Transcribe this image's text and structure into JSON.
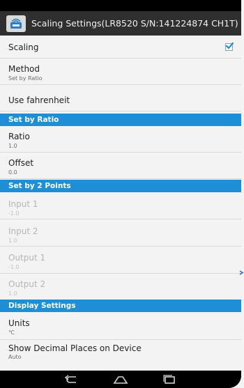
{
  "title": "Scaling Settings(LR8520 S/N:141224874 CH1T)",
  "items": {
    "scaling": {
      "label": "Scaling",
      "checked": true
    },
    "method": {
      "label": "Method",
      "summary": "Set by Ratio"
    },
    "use_fahrenheit": {
      "label": "Use fahrenheit"
    }
  },
  "sections": {
    "set_by_ratio": "Set by Ratio",
    "set_by_2_points": "Set by 2 Points",
    "display_settings": "Display Settings"
  },
  "ratio": {
    "label": "Ratio",
    "value": "1.0"
  },
  "offset": {
    "label": "Offset",
    "value": "0.0"
  },
  "input1": {
    "label": "Input 1",
    "value": "-1.0"
  },
  "input2": {
    "label": "Input 2",
    "value": "1.0"
  },
  "output1": {
    "label": "Output 1",
    "value": "-1.0"
  },
  "output2": {
    "label": "Output 2",
    "value": "1.0"
  },
  "units": {
    "label": "Units",
    "value": "℃"
  },
  "decimal": {
    "label": "Show Decimal Places on Device",
    "value": "Auto"
  },
  "colors": {
    "accent": "#1e8fd6",
    "actionbar": "#2f2f2f",
    "background": "#f3f3f3"
  },
  "icons": {
    "app": "wifi-logger-icon",
    "back": "back-icon",
    "home": "home-icon",
    "recents": "recents-icon"
  }
}
